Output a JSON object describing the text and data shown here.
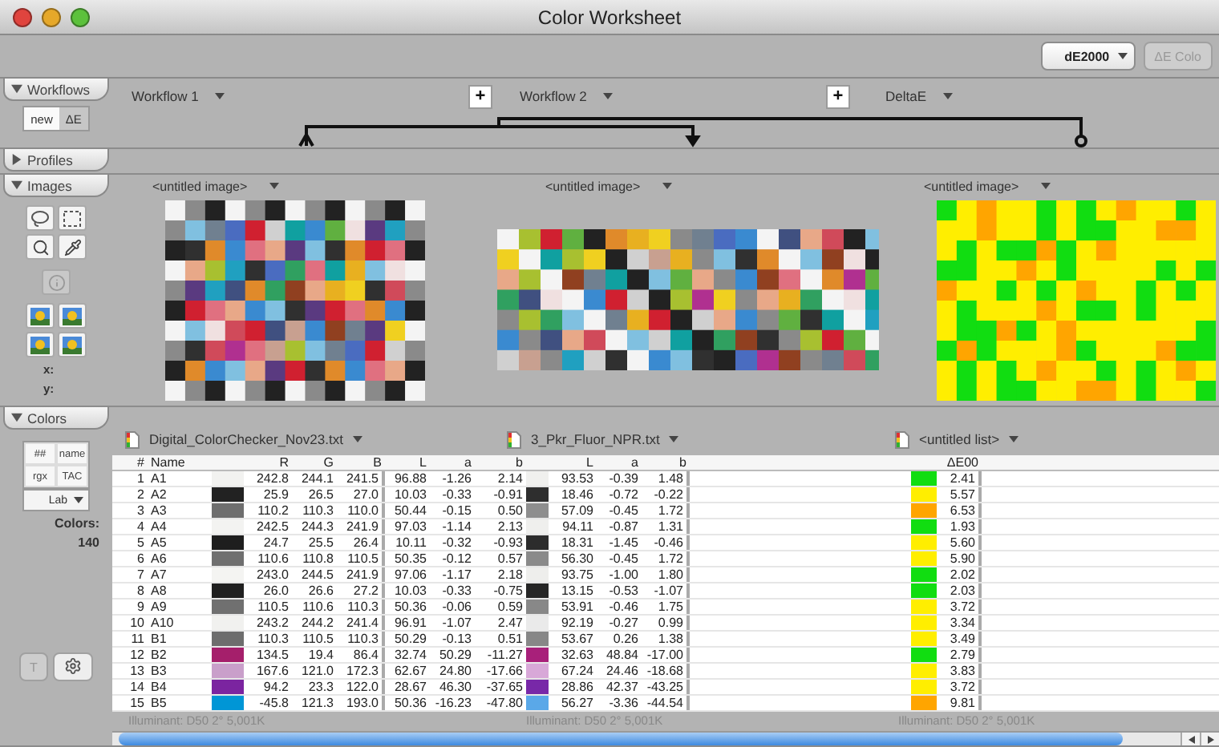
{
  "window": {
    "title": "Color Worksheet"
  },
  "toolbar": {
    "metric": "dE2000",
    "color_button": {
      "label": "ΔE Colo",
      "disabled": true
    }
  },
  "workflows": {
    "label": "Workflows",
    "expanded": true,
    "buttons": [
      "new",
      "ΔE"
    ],
    "steps": [
      "Workflow 1",
      "Workflow 2",
      "DeltaE"
    ],
    "add_buttons": [
      "+",
      "+"
    ]
  },
  "profiles": {
    "label": "Profiles",
    "expanded": false
  },
  "images": {
    "label": "Images",
    "expanded": true,
    "coords": [
      "x:",
      "y:"
    ],
    "items": [
      {
        "title": "<untitled image>",
        "kind": "picture"
      },
      {
        "title": "<untitled image>",
        "kind": "picture"
      },
      {
        "title": "<untitled image>",
        "kind": "picture"
      }
    ]
  },
  "colors": {
    "label": "Colors",
    "expanded": true,
    "buttons": [
      "##",
      "name",
      "rgx",
      "TAC"
    ],
    "space": "Lab",
    "count_label": "Colors:",
    "count": "140",
    "tool_button": {
      "label": "T",
      "disabled": true
    },
    "lists": [
      {
        "file": "Digital_ColorChecker_Nov23.txt",
        "lead_columns": [
          "#",
          "Name"
        ],
        "columns": [
          "R",
          "G",
          "B",
          "L",
          "a",
          "b"
        ],
        "footer": "Illuminant: D50 2° 5,001K",
        "rows": [
          {
            "lead": [
              "1",
              "A1"
            ],
            "color": "#f2f2f0",
            "values": [
              "242.8",
              "244.1",
              "241.5",
              "96.88",
              "-1.26",
              "2.14"
            ]
          },
          {
            "lead": [
              "2",
              "A2"
            ],
            "color": "#222222",
            "values": [
              "25.9",
              "26.5",
              "27.0",
              "10.03",
              "-0.33",
              "-0.91"
            ]
          },
          {
            "lead": [
              "3",
              "A3"
            ],
            "color": "#6e6e6e",
            "values": [
              "110.2",
              "110.3",
              "110.0",
              "50.44",
              "-0.15",
              "0.50"
            ]
          },
          {
            "lead": [
              "4",
              "A4"
            ],
            "color": "#f3f3f1",
            "values": [
              "242.5",
              "244.3",
              "241.9",
              "97.03",
              "-1.14",
              "2.13"
            ]
          },
          {
            "lead": [
              "5",
              "A5"
            ],
            "color": "#1e1e1e",
            "values": [
              "24.7",
              "25.5",
              "26.4",
              "10.11",
              "-0.32",
              "-0.93"
            ]
          },
          {
            "lead": [
              "6",
              "A6"
            ],
            "color": "#6f6f6f",
            "values": [
              "110.6",
              "110.8",
              "110.5",
              "50.35",
              "-0.12",
              "0.57"
            ]
          },
          {
            "lead": [
              "7",
              "A7"
            ],
            "color": "#f4f4f2",
            "values": [
              "243.0",
              "244.5",
              "241.9",
              "97.06",
              "-1.17",
              "2.18"
            ]
          },
          {
            "lead": [
              "8",
              "A8"
            ],
            "color": "#202020",
            "values": [
              "26.0",
              "26.6",
              "27.2",
              "10.03",
              "-0.33",
              "-0.75"
            ]
          },
          {
            "lead": [
              "9",
              "A9"
            ],
            "color": "#707070",
            "values": [
              "110.5",
              "110.6",
              "110.3",
              "50.36",
              "-0.06",
              "0.59"
            ]
          },
          {
            "lead": [
              "10",
              "A10"
            ],
            "color": "#f1f1ef",
            "values": [
              "243.2",
              "244.2",
              "241.4",
              "96.91",
              "-1.07",
              "2.47"
            ]
          },
          {
            "lead": [
              "11",
              "B1"
            ],
            "color": "#6d6d6d",
            "values": [
              "110.3",
              "110.5",
              "110.3",
              "50.29",
              "-0.13",
              "0.51"
            ]
          },
          {
            "lead": [
              "12",
              "B2"
            ],
            "color": "#a51f6b",
            "values": [
              "134.5",
              "19.4",
              "86.4",
              "32.74",
              "50.29",
              "-11.27"
            ]
          },
          {
            "lead": [
              "13",
              "B3"
            ],
            "color": "#c99fca",
            "values": [
              "167.6",
              "121.0",
              "172.3",
              "62.67",
              "24.80",
              "-17.66"
            ]
          },
          {
            "lead": [
              "14",
              "B4"
            ],
            "color": "#7b24a0",
            "values": [
              "94.2",
              "23.3",
              "122.0",
              "28.67",
              "46.30",
              "-37.65"
            ]
          },
          {
            "lead": [
              "15",
              "B5"
            ],
            "color": "#0096d6",
            "values": [
              "-45.8",
              "121.3",
              "193.0",
              "50.36",
              "-16.23",
              "-47.80"
            ]
          }
        ]
      },
      {
        "file": "3_Pkr_Fluor_NPR.txt",
        "columns": [
          "L",
          "a",
          "b"
        ],
        "footer": "Illuminant: D50 2° 5,001K",
        "rows": [
          {
            "color": "#f0f0ee",
            "values": [
              "93.53",
              "-0.39",
              "1.48"
            ]
          },
          {
            "color": "#2e2e2e",
            "values": [
              "18.46",
              "-0.72",
              "-0.22"
            ]
          },
          {
            "color": "#8e8e8e",
            "values": [
              "57.09",
              "-0.45",
              "1.72"
            ]
          },
          {
            "color": "#efefed",
            "values": [
              "94.11",
              "-0.87",
              "1.31"
            ]
          },
          {
            "color": "#2c2c2c",
            "values": [
              "18.31",
              "-1.45",
              "-0.46"
            ]
          },
          {
            "color": "#8a8a8a",
            "values": [
              "56.30",
              "-0.45",
              "1.72"
            ]
          },
          {
            "color": "#eeeeec",
            "values": [
              "93.75",
              "-1.00",
              "1.80"
            ]
          },
          {
            "color": "#262626",
            "values": [
              "13.15",
              "-0.53",
              "-1.07"
            ]
          },
          {
            "color": "#888888",
            "values": [
              "53.91",
              "-0.46",
              "1.75"
            ]
          },
          {
            "color": "#eaeaea",
            "values": [
              "92.19",
              "-0.27",
              "0.99"
            ]
          },
          {
            "color": "#878787",
            "values": [
              "53.67",
              "0.26",
              "1.38"
            ]
          },
          {
            "color": "#a8207a",
            "values": [
              "32.63",
              "48.84",
              "-17.00"
            ]
          },
          {
            "color": "#d8a8d8",
            "values": [
              "67.24",
              "24.46",
              "-18.68"
            ]
          },
          {
            "color": "#7828a8",
            "values": [
              "28.86",
              "42.37",
              "-43.25"
            ]
          },
          {
            "color": "#5aa8e8",
            "values": [
              "56.27",
              "-3.36",
              "-44.54"
            ]
          }
        ]
      },
      {
        "file": "<untitled list>",
        "columns": [
          "ΔE00"
        ],
        "footer": "Illuminant: D50 2° 5,001K",
        "rows": [
          {
            "color": "#11dd11",
            "values": [
              "2.41"
            ]
          },
          {
            "color": "#ffee00",
            "values": [
              "5.57"
            ]
          },
          {
            "color": "#ffa500",
            "values": [
              "6.53"
            ]
          },
          {
            "color": "#11dd11",
            "values": [
              "1.93"
            ]
          },
          {
            "color": "#ffee00",
            "values": [
              "5.60"
            ]
          },
          {
            "color": "#ffee00",
            "values": [
              "5.90"
            ]
          },
          {
            "color": "#11dd11",
            "values": [
              "2.02"
            ]
          },
          {
            "color": "#11dd11",
            "values": [
              "2.03"
            ]
          },
          {
            "color": "#ffee00",
            "values": [
              "3.72"
            ]
          },
          {
            "color": "#ffee00",
            "values": [
              "3.34"
            ]
          },
          {
            "color": "#ffee00",
            "values": [
              "3.49"
            ]
          },
          {
            "color": "#11dd11",
            "values": [
              "2.79"
            ]
          },
          {
            "color": "#ffee00",
            "values": [
              "3.83"
            ]
          },
          {
            "color": "#ffee00",
            "values": [
              "3.72"
            ]
          },
          {
            "color": "#ffa500",
            "values": [
              "9.81"
            ]
          }
        ]
      }
    ]
  }
}
